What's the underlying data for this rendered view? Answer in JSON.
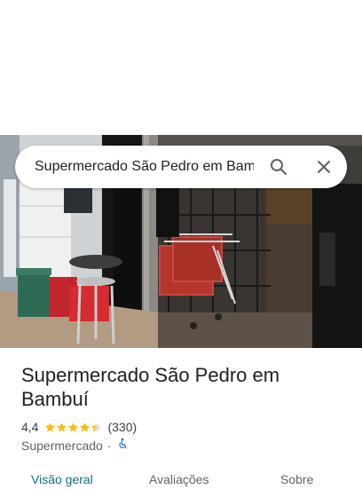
{
  "search": {
    "value": "Supermercado São Pedro em Bambuí",
    "search_icon": "search-icon",
    "close_icon": "close-icon"
  },
  "place": {
    "name": "Supermercado São Pedro em Bambuí",
    "rating": "4,4",
    "stars": 4.4,
    "review_count": "(330)",
    "category": "Supermercado",
    "separator": "·",
    "accessibility_icon": "wheelchair-accessible-icon"
  },
  "tabs": [
    {
      "label": "Visão geral",
      "active": true
    },
    {
      "label": "Avaliações",
      "active": false
    },
    {
      "label": "Sobre",
      "active": false
    }
  ],
  "colors": {
    "star": "#fbbc04",
    "accent_tab": "#0b7285",
    "accessibility": "#1a73e8"
  }
}
